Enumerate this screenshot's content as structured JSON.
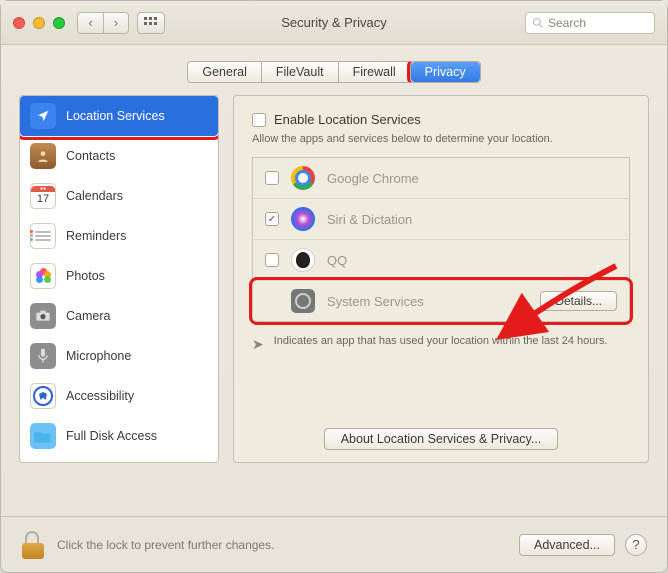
{
  "window": {
    "title": "Security & Privacy"
  },
  "search": {
    "placeholder": "Search"
  },
  "tabs": [
    {
      "label": "General"
    },
    {
      "label": "FileVault"
    },
    {
      "label": "Firewall"
    },
    {
      "label": "Privacy"
    }
  ],
  "sidebar": {
    "items": [
      {
        "label": "Location Services"
      },
      {
        "label": "Contacts"
      },
      {
        "label": "Calendars",
        "badge_day": "17"
      },
      {
        "label": "Reminders"
      },
      {
        "label": "Photos"
      },
      {
        "label": "Camera"
      },
      {
        "label": "Microphone"
      },
      {
        "label": "Accessibility"
      },
      {
        "label": "Full Disk Access"
      }
    ]
  },
  "main": {
    "enable_label": "Enable Location Services",
    "enable_checked": false,
    "subtext": "Allow the apps and services below to determine your location.",
    "apps": [
      {
        "name": "Google Chrome",
        "checked": false
      },
      {
        "name": "Siri & Dictation",
        "checked": true
      },
      {
        "name": "QQ",
        "checked": false
      },
      {
        "name": "System Services",
        "checked": null,
        "details_label": "Details..."
      }
    ],
    "indicator_text": "Indicates an app that has used your location within the last 24 hours.",
    "about_label": "About Location Services & Privacy..."
  },
  "footer": {
    "lock_text": "Click the lock to prevent further changes.",
    "advanced_label": "Advanced...",
    "help_label": "?"
  }
}
